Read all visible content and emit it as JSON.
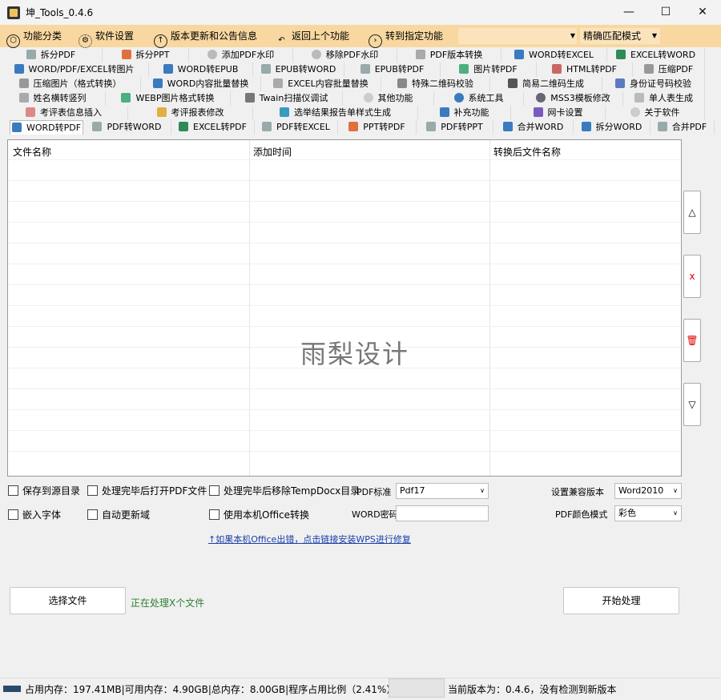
{
  "window": {
    "title": "坤_Tools_0.4.6",
    "minimize": "—",
    "maximize": "☐",
    "close": "✕"
  },
  "toolbar": {
    "function_category": "功能分类",
    "software_settings": "软件设置",
    "version_update": "版本更新和公告信息",
    "return_previous": "返回上个功能",
    "goto_function": "转到指定功能",
    "goto_input_value": "",
    "match_mode": "精确匹配模式"
  },
  "tabs": {
    "row1": [
      "拆分PDF",
      "拆分PPT",
      "添加PDF水印",
      "移除PDF水印",
      "PDF版本转换",
      "WORD转EXCEL",
      "EXCEL转WORD"
    ],
    "row2": [
      "WORD/PDF/EXCEL转图片",
      "WORD转EPUB",
      "EPUB转WORD",
      "EPUB转PDF",
      "图片转PDF",
      "HTML转PDF",
      "压缩PDF"
    ],
    "row3": [
      "压缩图片（格式转换）",
      "WORD内容批量替换",
      "EXCEL内容批量替换",
      "特殊二维码校验",
      "简易二维码生成",
      "身份证号码校验"
    ],
    "row4": [
      "姓名横转竖列",
      "WEBP图片格式转换",
      "Twain扫描仪调试",
      "其他功能",
      "系统工具",
      "MSS3模板修改",
      "单人表生成"
    ],
    "row5": [
      "考评表信息插入",
      "考评报表修改",
      "选举结果报告单样式生成",
      "补充功能",
      "网卡设置",
      "关于软件"
    ],
    "row6": [
      "WORD转PDF",
      "PDF转WORD",
      "EXCEL转PDF",
      "PDF转EXCEL",
      "PPT转PDF",
      "PDF转PPT",
      "合并WORD",
      "拆分WORD",
      "合并PDF"
    ]
  },
  "file_table": {
    "columns": [
      "文件名称",
      "添加时间",
      "转换后文件名称"
    ],
    "rows": [],
    "watermark": "雨梨设计"
  },
  "side_buttons": {
    "up": "△",
    "remove": "x",
    "clear": "🗑",
    "down": "▽"
  },
  "options": {
    "save_to_source": "保存到源目录",
    "open_pdf_after": "处理完毕后打开PDF文件",
    "remove_temp_after": "处理完毕后移除TempDocx目录",
    "embed_fonts": "嵌入字体",
    "auto_update_fields": "自动更新域",
    "use_local_office": "使用本机Office转换",
    "pdf_standard_label": "PDF标准",
    "pdf_standard_value": "Pdf17",
    "word_password_label": "WORD密码",
    "word_password_value": "",
    "compat_version_label": "设置兼容版本",
    "compat_version_value": "Word2010",
    "pdf_color_label": "PDF颜色模式",
    "pdf_color_value": "彩色"
  },
  "link_text": "↑如果本机Office出错，点击链接安装WPS进行修复",
  "select_file": "选择文件",
  "processing_status": "正在处理X个文件",
  "start_processing": "开始处理",
  "status_bar": {
    "memory": "占用内存：197.41MB|可用内存：4.90GB|总内存：8.00GB|程序占用比例（2.41%）",
    "version": "当前版本为：0.4.6，没有检测到新版本"
  },
  "colors": {
    "toolbar_bg": "#f8d8a0",
    "link": "#1a3ea8",
    "status_green": "#2e7d32"
  }
}
